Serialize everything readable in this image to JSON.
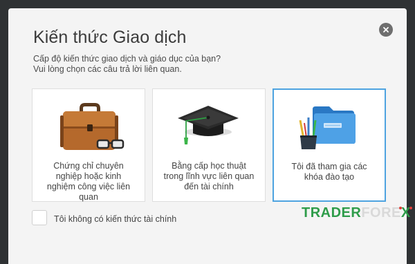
{
  "modal": {
    "title": "Kiến thức Giao dịch",
    "subtitle_line1": "Cấp độ kiến thức giao dịch và giáo dục của bạn?",
    "subtitle_line2": "Vui lòng chọn các câu trả lời liên quan."
  },
  "options": [
    {
      "label": "Chứng chỉ chuyên nghiệp hoặc kinh nghiệm công việc liên quan",
      "icon": "briefcase-glasses-icon",
      "selected": false
    },
    {
      "label": "Bằng cấp học thuật trong lĩnh vực liên quan đến tài chính",
      "icon": "graduation-cap-icon",
      "selected": false
    },
    {
      "label": "Tôi đã tham gia các khóa đào tạo",
      "icon": "folder-pencils-icon",
      "selected": true
    }
  ],
  "no_knowledge": {
    "label": "Tôi không có kiến thức tài chính",
    "checked": false
  },
  "watermark": {
    "part_a": "TRADER",
    "part_b": "FORE",
    "part_c": "X"
  },
  "colors": {
    "accent": "#4da3e0",
    "brand_green": "#2e9c4a",
    "backdrop": "#2f3234"
  }
}
